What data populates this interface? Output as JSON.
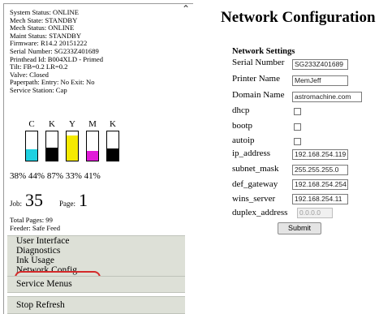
{
  "status": {
    "lines": [
      "System Status: ONLINE",
      "Mech State: STANDBY",
      "Mech Status: ONLINE",
      "Maint Status: STANDBY",
      "Firmware: R14.2 20151222",
      "Serial Number: SG233Z401689",
      "Printhead Id: B004XLD - Primed",
      "Tilt: FB=0.2 LR=0.2",
      "Valve: Closed",
      "Paperpath: Entry: No Exit: No",
      "Service Station: Cap"
    ]
  },
  "ink": {
    "cartridges": [
      {
        "letter": "C",
        "percent": "38%",
        "level": 0.38,
        "color": "#1fd0e0"
      },
      {
        "letter": "K",
        "percent": "44%",
        "level": 0.44,
        "color": "#000000"
      },
      {
        "letter": "Y",
        "percent": "87%",
        "level": 0.87,
        "color": "#f5ea00"
      },
      {
        "letter": "M",
        "percent": "33%",
        "level": 0.33,
        "color": "#e01ad8"
      },
      {
        "letter": "K",
        "percent": "41%",
        "level": 0.41,
        "color": "#000000"
      }
    ],
    "percents_text": "38% 44% 87% 33% 41%"
  },
  "job": {
    "job_label": "Job:",
    "job_value": "35",
    "page_label": "Page:",
    "page_value": "1"
  },
  "totals": {
    "total_pages": "Total Pages: 99",
    "feeder": "Feeder: Safe Feed"
  },
  "menu": {
    "items": [
      "User Interface",
      "Diagnostics",
      "Ink Usage",
      "Network Config"
    ],
    "service": "Service Menus",
    "stop": "Stop Refresh"
  },
  "network": {
    "title": "Network Configuration",
    "section": "Network Settings",
    "serial_label": "Serial Number",
    "serial_value": "SG233Z401689",
    "printer_label": "Printer Name",
    "printer_value": "MemJeff",
    "domain_label": "Domain Name",
    "domain_value": "astromachine.com",
    "dhcp_label": "dhcp",
    "bootp_label": "bootp",
    "autoip_label": "autoip",
    "ip_label": "ip_address",
    "ip_value": "192.168.254.119",
    "mask_label": "subnet_mask",
    "mask_value": "255.255.255.0",
    "gateway_label": "def_gateway",
    "gateway_value": "192.168.254.254",
    "wins_label": "wins_server",
    "wins_value": "192.168.254.11",
    "duplex_label": "duplex_address",
    "duplex_value": "0.0.0.0",
    "submit": "Submit"
  },
  "colors": {
    "menu_bg": "#dde0d7",
    "highlight": "#d42a2a"
  },
  "icons": {
    "scroll_up": "chevron-up-icon"
  }
}
